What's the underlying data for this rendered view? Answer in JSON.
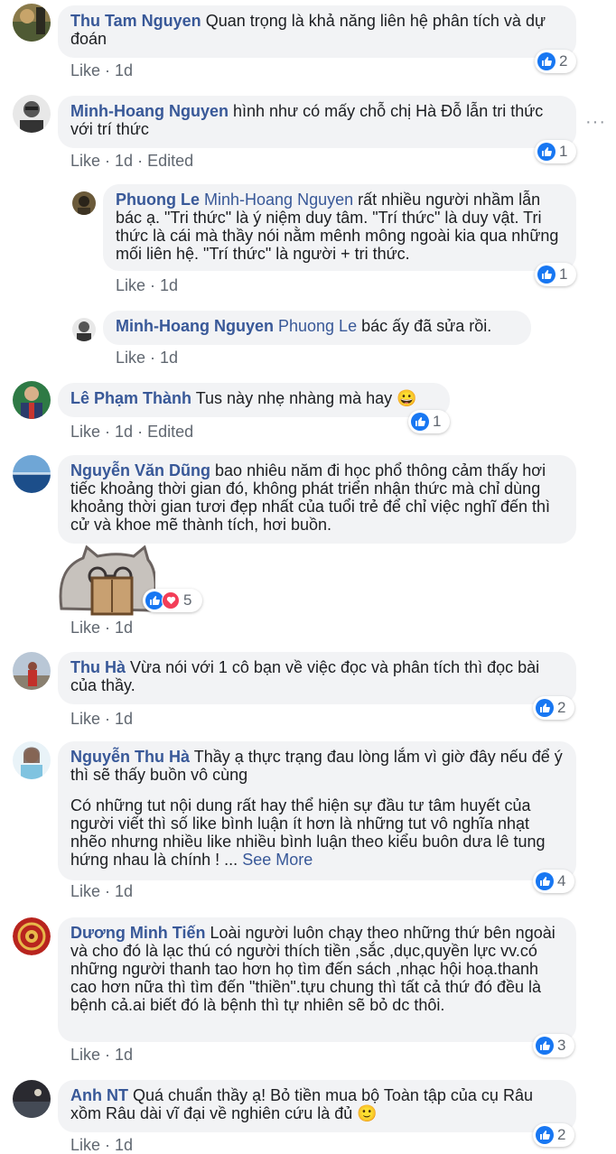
{
  "comments": [
    {
      "author": "Thu Tam Nguyen",
      "text": "Quan trọng là khả năng liên hệ phân tích và dự đoán",
      "like": "Like",
      "time": "1d",
      "reactions": "2"
    },
    {
      "author": "Minh-Hoang Nguyen",
      "text": "hình như có mấy chỗ chị Hà Đỗ lẫn tri thức với trí thức",
      "like": "Like",
      "time": "1d",
      "edited": "Edited",
      "reactions": "1",
      "more": "···"
    },
    {
      "author": "Phuong Le",
      "mention": "Minh-Hoang Nguyen",
      "text": "rất nhiều người nhầm lẫn bác ạ. \"Tri thức\" là ý niệm duy tâm. \"Trí thức\" là duy vật. Tri thức là cái mà thầy nói nằm mênh mông ngoài kia qua những mối liên hệ. \"Trí thức\" là người + tri thức.",
      "like": "Like",
      "time": "1d",
      "reactions": "1"
    },
    {
      "author": "Minh-Hoang Nguyen",
      "mention": "Phuong Le",
      "text": "bác ấy đã sửa rồi.",
      "like": "Like",
      "time": "1d"
    },
    {
      "author": "Lê Phạm Thành",
      "text": "Tus này nhẹ nhàng mà hay 😀",
      "like": "Like",
      "time": "1d",
      "edited": "Edited",
      "reactions": "1"
    },
    {
      "author": "Nguyễn Văn Dũng",
      "text": "bao nhiêu năm đi học phổ thông cảm thấy hơi tiếc khoảng thời gian đó, không phát triển nhận thức mà chỉ dùng khoảng thời gian tươi đẹp nhất của tuổi trẻ để chỉ việc nghĩ đến thì cử và khoe mẽ thành tích, hơi buồn.",
      "like": "Like",
      "time": "1d",
      "reactions": "5"
    },
    {
      "author": "Thu Hà",
      "text": "Vừa nói với 1 cô bạn về việc đọc và phân tích thì đọc bài của thầy.",
      "like": "Like",
      "time": "1d",
      "reactions": "2"
    },
    {
      "author": "Nguyễn Thu Hà",
      "text": "Thầy ạ thực trạng đau lòng lắm vì giờ đây nếu để ý thì sẽ thấy buồn vô cùng",
      "text2": "Có những tut nội dung rất hay thể hiện sự đầu tư tâm huyết của người viết thì số like bình luận ít hơn là những tut vô nghĩa nhạt nhẽo nhưng nhiều like nhiều bình luận theo kiểu buôn dưa lê tung hứng nhau là chính ! ...",
      "see_more": "See More",
      "like": "Like",
      "time": "1d",
      "reactions": "4"
    },
    {
      "author": "Dương Minh Tiến",
      "text": "Loài người luôn chạy theo những thứ bên ngoài và cho đó là lạc thú có người thích tiền ,sắc ,dục,quyền lực vv.có những người thanh tao hơn họ tìm đến sách ,nhạc hội hoạ.thanh cao hơn nữa thì tìm đến \"thiền\".tựu chung thì tất cả thứ đó đều là bệnh cả.ai biết đó là bệnh thì tự nhiên sẽ bỏ dc thôi.",
      "like": "Like",
      "time": "1d",
      "reactions": "3"
    },
    {
      "author": "Anh NT",
      "text": "Quá chuẩn thầy ạ! Bỏ tiền mua bộ Toàn tập của cụ Râu xồm Râu dài vĩ đại về nghiên cứu là đủ 🙂",
      "like": "Like",
      "time": "1d",
      "reactions": "2"
    }
  ],
  "colors": {
    "author": "#385898",
    "bubble": "#f2f3f5",
    "meta": "#606770",
    "like_blue": "#1877f2",
    "love_red": "#f33e58"
  }
}
